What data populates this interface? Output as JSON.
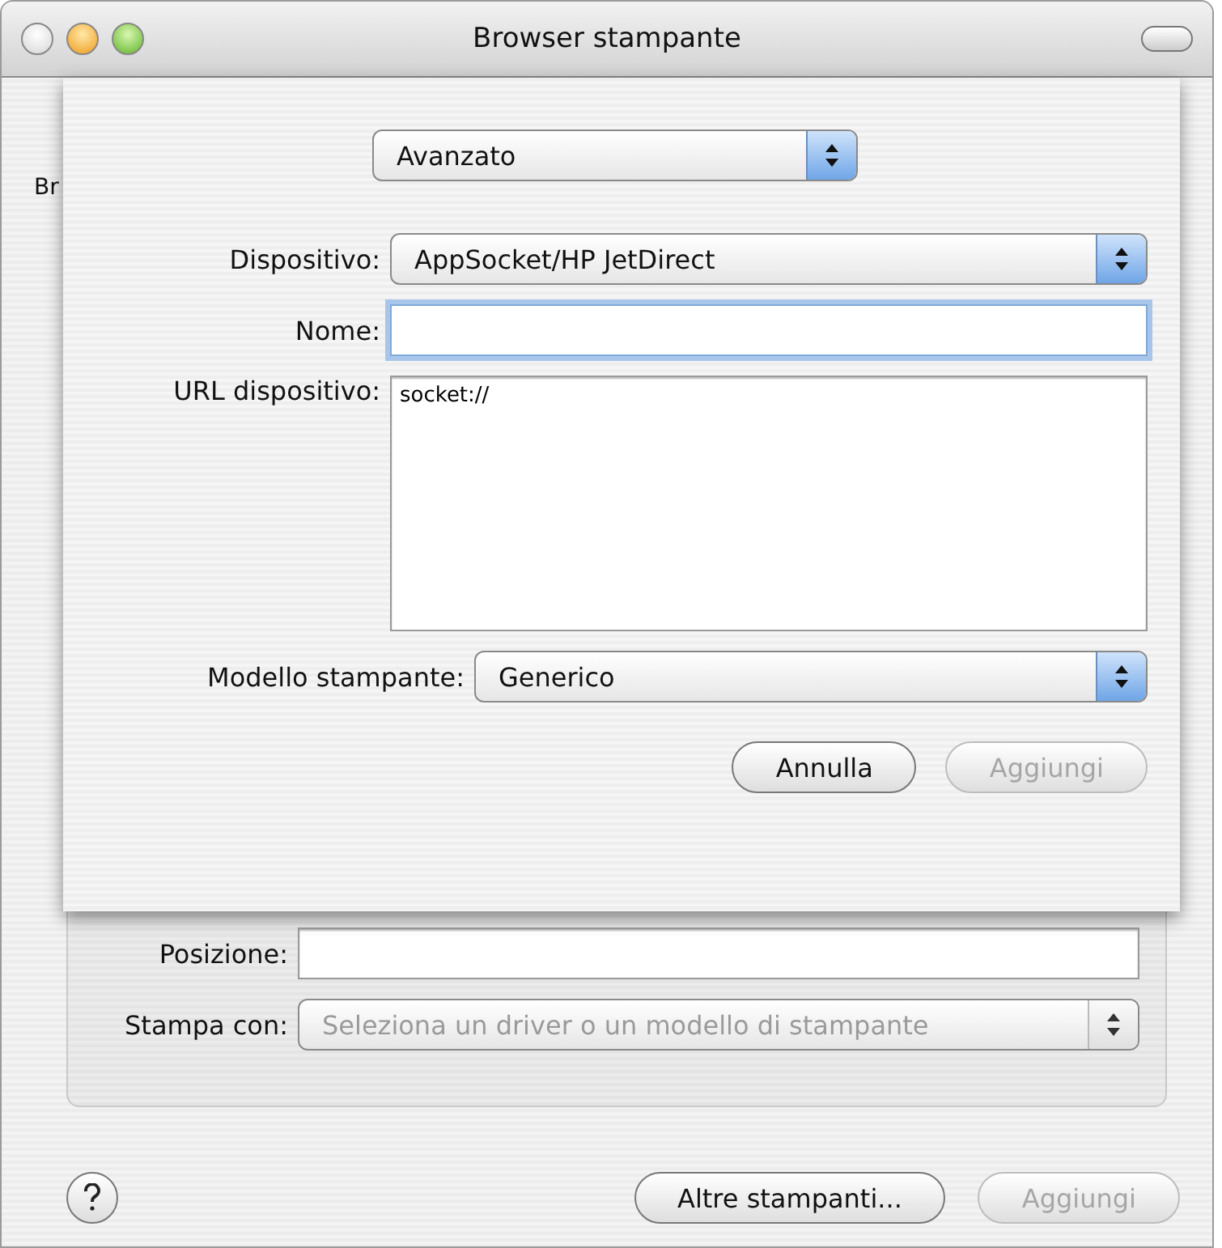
{
  "window": {
    "title": "Browser stampante"
  },
  "background": {
    "toolbar_text": "Br",
    "fields": [
      {
        "label": "Posizione:",
        "kind": "text",
        "disabled": false
      },
      {
        "label": "Stampa con:",
        "kind": "popup",
        "value": "Seleziona un driver o un modello di stampante",
        "disabled": true
      }
    ],
    "buttons": [
      {
        "label": "Altre stampanti...",
        "disabled": false
      },
      {
        "label": "Aggiungi",
        "disabled": true
      }
    ]
  },
  "sheet": {
    "mode_popup": "Avanzato",
    "device": {
      "label": "Dispositivo:",
      "value": "AppSocket/HP JetDirect"
    },
    "name": {
      "label": "Nome:",
      "focused": true
    },
    "url": {
      "label": "URL dispositivo:",
      "value": "socket://"
    },
    "model": {
      "label": "Modello stampante:",
      "value": "Generico"
    },
    "buttons": [
      {
        "label": "Annulla",
        "disabled": false
      },
      {
        "label": "Aggiungi",
        "disabled": true
      }
    ]
  }
}
